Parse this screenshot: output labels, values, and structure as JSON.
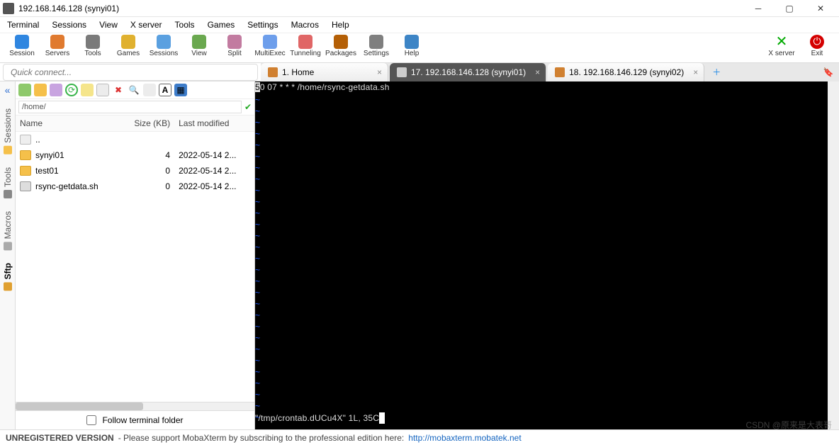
{
  "window": {
    "title": "192.168.146.128 (synyi01)"
  },
  "menu": [
    "Terminal",
    "Sessions",
    "View",
    "X server",
    "Tools",
    "Games",
    "Settings",
    "Macros",
    "Help"
  ],
  "toolbar": [
    {
      "name": "session",
      "label": "Session",
      "color": "#2f86e0"
    },
    {
      "name": "servers",
      "label": "Servers",
      "color": "#e07a2f"
    },
    {
      "name": "tools",
      "label": "Tools",
      "color": "#7a7a7a"
    },
    {
      "name": "games",
      "label": "Games",
      "color": "#e0b12f"
    },
    {
      "name": "sessions",
      "label": "Sessions",
      "color": "#5aa0e0"
    },
    {
      "name": "view",
      "label": "View",
      "color": "#6aa84f"
    },
    {
      "name": "split",
      "label": "Split",
      "color": "#c27ba0"
    },
    {
      "name": "multiexec",
      "label": "MultiExec",
      "color": "#6d9eeb"
    },
    {
      "name": "tunneling",
      "label": "Tunneling",
      "color": "#e06666"
    },
    {
      "name": "packages",
      "label": "Packages",
      "color": "#b45f06"
    },
    {
      "name": "settings",
      "label": "Settings",
      "color": "#7f7f7f"
    },
    {
      "name": "help",
      "label": "Help",
      "color": "#3d85c6"
    }
  ],
  "toolbar_right": {
    "xserver": "X server",
    "exit": "Exit"
  },
  "quickconnect": {
    "placeholder": "Quick connect..."
  },
  "tabs": [
    {
      "label": "1. Home",
      "active": false
    },
    {
      "label": "17. 192.168.146.128 (synyi01)",
      "active": true
    },
    {
      "label": "18. 192.168.146.129  (synyi02)",
      "active": false
    }
  ],
  "sidetabs": [
    "Sessions",
    "Tools",
    "Macros",
    "Sftp"
  ],
  "sftp": {
    "path": "/home/",
    "columns": [
      "Name",
      "Size (KB)",
      "Last modified"
    ],
    "rows": [
      {
        "icon": "file",
        "name": "..",
        "size": "",
        "mod": ""
      },
      {
        "icon": "folder",
        "name": "synyi01",
        "size": "4",
        "mod": "2022-05-14 2..."
      },
      {
        "icon": "folder",
        "name": "test01",
        "size": "0",
        "mod": "2022-05-14 2..."
      },
      {
        "icon": "sh",
        "name": "rsync-getdata.sh",
        "size": "0",
        "mod": "2022-05-14 2..."
      }
    ],
    "follow_label": "Follow terminal folder"
  },
  "terminal": {
    "line": "50 07 * * * /home/rsync-getdata.sh",
    "status": "\"/tmp/crontab.dUCu4X\" 1L, 35C"
  },
  "statusbar": {
    "unreg": "UNREGISTERED VERSION",
    "msg": "  -  Please support MobaXterm by subscribing to the professional edition here:  ",
    "url": "http://mobaxterm.mobatek.net"
  },
  "watermark": "CSDN @原来是大表哥"
}
